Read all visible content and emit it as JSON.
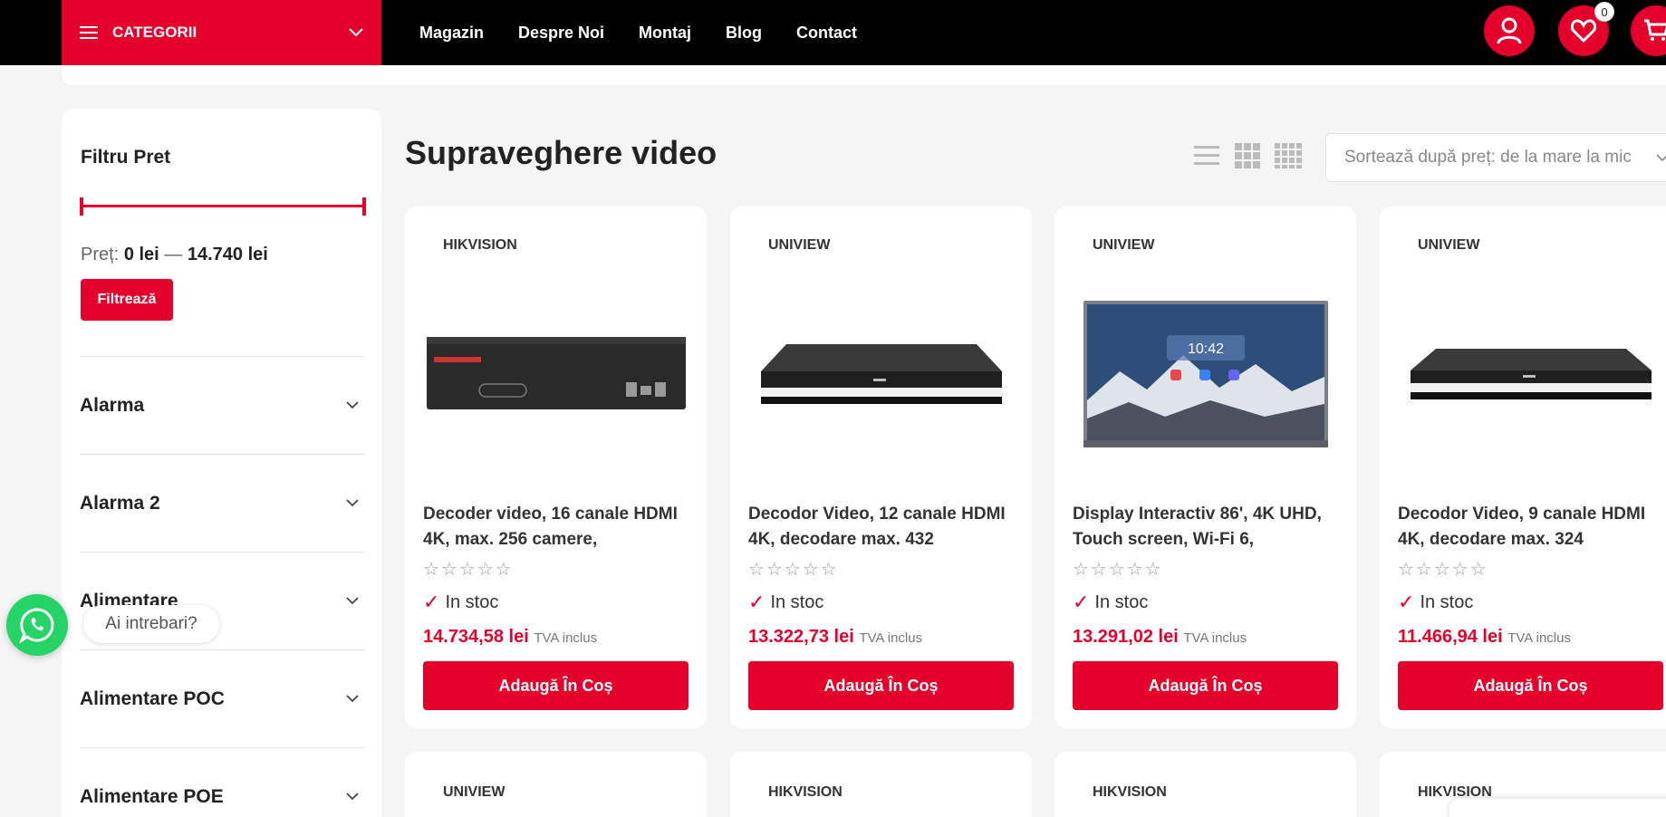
{
  "header": {
    "categories_label": "CATEGORII",
    "nav": [
      "Magazin",
      "Despre Noi",
      "Montaj",
      "Blog",
      "Contact"
    ],
    "wishlist_count": "0"
  },
  "sidebar": {
    "filter_title": "Filtru Pret",
    "price_label": "Preț:",
    "price_min": "0 lei",
    "price_sep": "—",
    "price_max": "14.740 lei",
    "filter_button": "Filtrează",
    "categories": [
      "Alarma",
      "Alarma 2",
      "Alimentare",
      "Alimentare POC",
      "Alimentare POE"
    ]
  },
  "main": {
    "title": "Supraveghere video",
    "sort_selected": "Sortează după preț: de la mare la mic"
  },
  "products": [
    {
      "brand": "HIKVISION",
      "name": "Decoder video, 16 canale HDMI 4K, max. 256 camere,",
      "stars": "☆☆☆☆☆",
      "stock": "In stoc",
      "price": "14.734,58 lei",
      "tva": "TVA inclus",
      "button": "Adaugă În Coș"
    },
    {
      "brand": "UNIVIEW",
      "name": "Decodor Video, 12 canale HDMI 4K, decodare max. 432",
      "stars": "☆☆☆☆☆",
      "stock": "In stoc",
      "price": "13.322,73 lei",
      "tva": "TVA inclus",
      "button": "Adaugă În Coș"
    },
    {
      "brand": "UNIVIEW",
      "name": "Display Interactiv 86', 4K UHD, Touch screen, Wi-Fi 6,",
      "stars": "☆☆☆☆☆",
      "stock": "In stoc",
      "price": "13.291,02 lei",
      "tva": "TVA inclus",
      "button": "Adaugă În Coș"
    },
    {
      "brand": "UNIVIEW",
      "name": "Decodor Video, 9 canale HDMI 4K, decodare max. 324",
      "stars": "☆☆☆☆☆",
      "stock": "In stoc",
      "price": "11.466,94 lei",
      "tva": "TVA inclus",
      "button": "Adaugă În Coș"
    }
  ],
  "products_row2_brands": [
    "UNIVIEW",
    "HIKVISION",
    "HIKVISION",
    "HIKVISION"
  ],
  "whatsapp": {
    "bubble": "Ai intrebari?"
  },
  "display_time": "10:42",
  "colors": {
    "accent": "#e4002b",
    "topbar": "#000000",
    "background": "#f5f5f5",
    "whatsapp": "#25d366"
  },
  "icons": [
    "menu-icon",
    "chevron-down-icon",
    "user-icon",
    "heart-icon",
    "cart-icon",
    "list-view-icon",
    "grid-3-icon",
    "grid-4-icon",
    "check-icon",
    "whatsapp-icon"
  ]
}
